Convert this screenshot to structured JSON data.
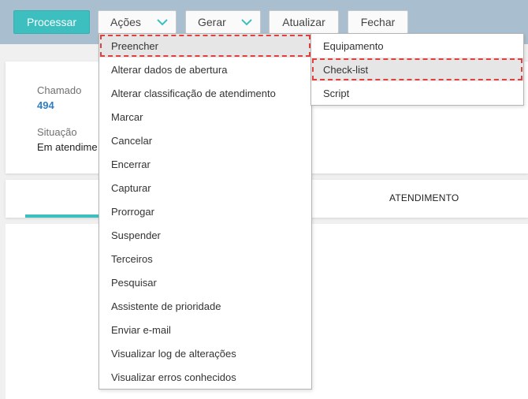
{
  "toolbar": {
    "processar": "Processar",
    "acoes": "Ações",
    "gerar": "Gerar",
    "atualizar": "Atualizar",
    "fechar": "Fechar"
  },
  "ticket": {
    "chamado_label": "Chamado",
    "chamado_value": "494",
    "situacao_label": "Situação",
    "situacao_value": "Em atendime"
  },
  "tabs": {
    "active_label": "ATENDIMENTO"
  },
  "acoes_menu": {
    "items": [
      {
        "label": "Preencher",
        "selected": true
      },
      {
        "label": "Alterar dados de abertura"
      },
      {
        "label": "Alterar classificação de atendimento"
      },
      {
        "label": "Marcar"
      },
      {
        "label": "Cancelar"
      },
      {
        "label": "Encerrar"
      },
      {
        "label": "Capturar"
      },
      {
        "label": "Prorrogar"
      },
      {
        "label": "Suspender"
      },
      {
        "label": "Terceiros"
      },
      {
        "label": "Pesquisar"
      },
      {
        "label": "Assistente de prioridade"
      },
      {
        "label": "Enviar e-mail"
      },
      {
        "label": "Visualizar log de alterações"
      },
      {
        "label": "Visualizar erros conhecidos"
      }
    ]
  },
  "preencher_submenu": {
    "items": [
      {
        "label": "Equipamento"
      },
      {
        "label": "Check-list",
        "selected": true
      },
      {
        "label": "Script"
      }
    ]
  },
  "colors": {
    "accent": "#3dbfbf",
    "topbar": "#a9bfcf",
    "link": "#2f7ec1",
    "highlight_outline": "#e0413f"
  },
  "icons": {
    "dropdown": "chevron-down-icon"
  }
}
